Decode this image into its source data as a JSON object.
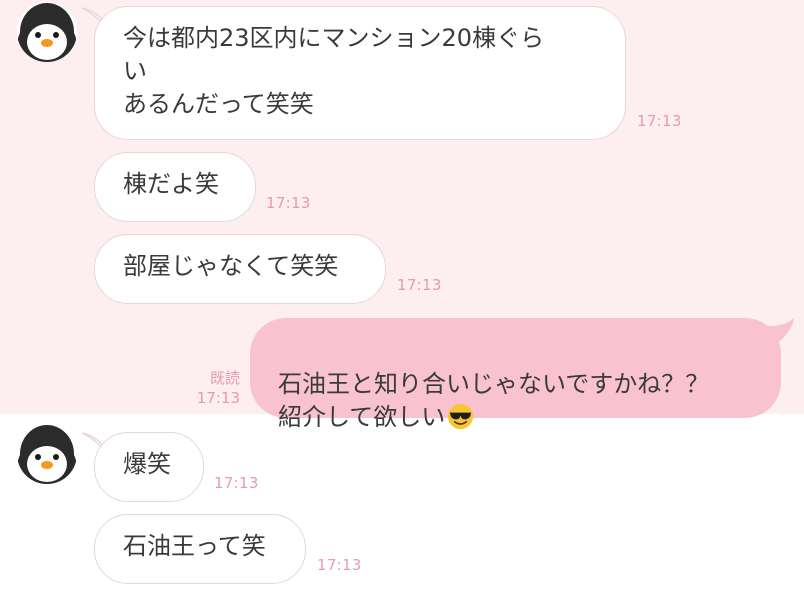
{
  "messages": [
    {
      "text": "今は都内23区内にマンション20棟ぐら\nい\nあるんだって笑笑",
      "time": "17:13"
    },
    {
      "text": "棟だよ笑",
      "time": "17:13"
    },
    {
      "text": "部屋じゃなくて笑笑",
      "time": "17:13"
    },
    {
      "text": "石油王と知り合いじゃないですかね？？\n紹介して欲しい",
      "time": "17:13",
      "read": "既読",
      "emoji": "smiling-face-with-sunglasses"
    },
    {
      "text": "爆笑",
      "time": "17:13"
    },
    {
      "text": "石油王って笑",
      "time": "17:13"
    }
  ],
  "colors": {
    "background_top": "#fdeef0",
    "incoming_bubble": "#ffffff",
    "outgoing_bubble": "#f8c3cf",
    "timestamp": "#e79bae"
  }
}
